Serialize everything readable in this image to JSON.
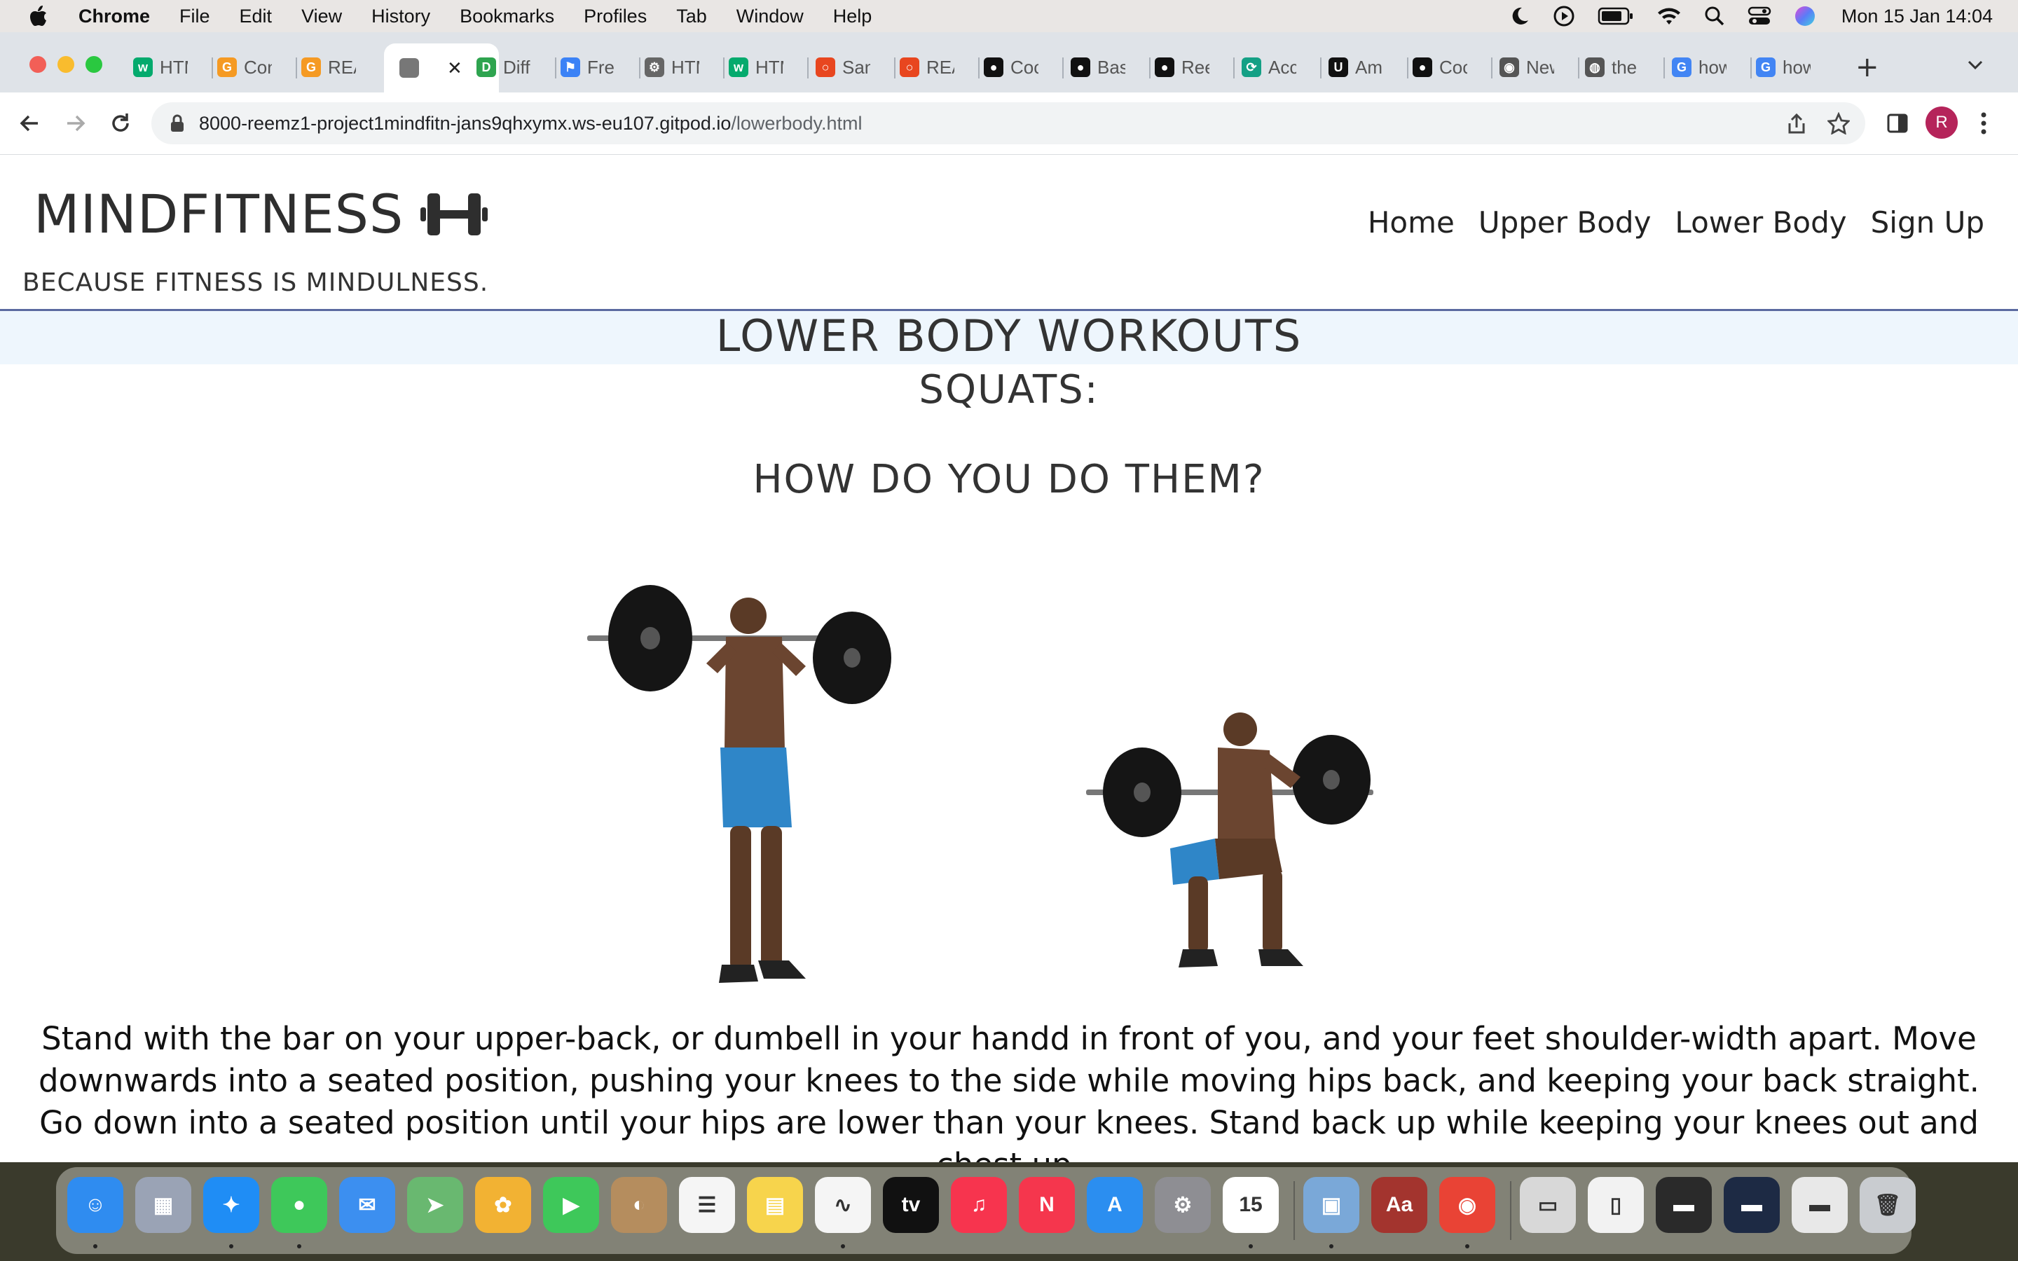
{
  "menubar": {
    "app_name": "Chrome",
    "items": [
      "File",
      "Edit",
      "View",
      "History",
      "Bookmarks",
      "Profiles",
      "Tab",
      "Window",
      "Help"
    ],
    "clock": "Mon 15 Jan  14:04"
  },
  "tabs": [
    {
      "title": "HTML",
      "favicon": "w3schools-icon",
      "color": "#04aa6d",
      "glyph": "w"
    },
    {
      "title": "Con",
      "favicon": "g-orange-icon",
      "color": "#f59a23",
      "glyph": "G"
    },
    {
      "title": "REA",
      "favicon": "g-orange-icon",
      "color": "#f59a23",
      "glyph": "G"
    },
    {
      "title": "",
      "favicon": "page-icon",
      "color": "#777777",
      "glyph": "",
      "active": true
    },
    {
      "title": "Diff",
      "favicon": "diffchecker-icon",
      "color": "#2ea44f",
      "glyph": "D"
    },
    {
      "title": "Free",
      "favicon": "flag-icon",
      "color": "#3b82f6",
      "glyph": "⚑"
    },
    {
      "title": "HTM",
      "favicon": "gear-icon",
      "color": "#666666",
      "glyph": "⚙"
    },
    {
      "title": "HTM",
      "favicon": "w3schools-icon",
      "color": "#04aa6d",
      "glyph": "w"
    },
    {
      "title": "San",
      "favicon": "circle-red-icon",
      "color": "#e8461f",
      "glyph": "○"
    },
    {
      "title": "REA",
      "favicon": "circle-red-icon",
      "color": "#e8461f",
      "glyph": "○"
    },
    {
      "title": "Coc",
      "favicon": "github-icon",
      "color": "#111111",
      "glyph": "●"
    },
    {
      "title": "Bas",
      "favicon": "github-icon",
      "color": "#111111",
      "glyph": "●"
    },
    {
      "title": "Ree",
      "favicon": "github-icon",
      "color": "#111111",
      "glyph": "●"
    },
    {
      "title": "Acc",
      "favicon": "app-icon",
      "color": "#14a085",
      "glyph": "⟳"
    },
    {
      "title": "Am",
      "favicon": "udemy-icon",
      "color": "#111111",
      "glyph": "U"
    },
    {
      "title": "Coc",
      "favicon": "github-icon",
      "color": "#111111",
      "glyph": "●"
    },
    {
      "title": "New",
      "favicon": "chrome-icon",
      "color": "#555555",
      "glyph": "◉"
    },
    {
      "title": "the",
      "favicon": "globe-icon",
      "color": "#555555",
      "glyph": "◍"
    },
    {
      "title": "how",
      "favicon": "google-icon",
      "color": "#4285f4",
      "glyph": "G"
    },
    {
      "title": "how",
      "favicon": "google-icon",
      "color": "#4285f4",
      "glyph": "G"
    }
  ],
  "toolbar": {
    "url_host": "8000-reemz1-project1mindfitn-jans9qhxymx.ws-eu107.gitpod.io",
    "url_path": "/lowerbody.html",
    "avatar_letter": "R"
  },
  "page": {
    "logo_text": "MINDFITNESS",
    "tagline": "BECAUSE FITNESS IS MINDULNESS.",
    "nav": [
      "Home",
      "Upper Body",
      "Lower Body",
      "Sign Up"
    ],
    "heading": "LOWER BODY WORKOUTS",
    "subheading": "SQUATS:",
    "question": "HOW DO YOU DO THEM?",
    "images": [
      "squat-standing-image",
      "squat-bottom-image"
    ],
    "paragraph": "Stand with the bar on your upper-back, or dumbell in your handd in front of you, and your feet shoulder-width apart. Move downwards into a seated position, pushing your knees to the side while moving hips back, and keeping your back straight. Go down into a seated position until your hips are lower than your knees. Stand back up while keeping your knees out and chest up."
  },
  "dock": {
    "apps": [
      {
        "name": "finder-icon",
        "color": "#2f8cf0",
        "glyph": "☺"
      },
      {
        "name": "launchpad-icon",
        "color": "#9aa3b5",
        "glyph": "▦"
      },
      {
        "name": "safari-icon",
        "color": "#1f8df5",
        "glyph": "✦"
      },
      {
        "name": "messages-icon",
        "color": "#3ec85a",
        "glyph": "●"
      },
      {
        "name": "mail-icon",
        "color": "#3c8ff0",
        "glyph": "✉"
      },
      {
        "name": "maps-icon",
        "color": "#69b870",
        "glyph": "➤"
      },
      {
        "name": "photos-icon",
        "color": "#f2b233",
        "glyph": "✿"
      },
      {
        "name": "facetime-icon",
        "color": "#3ec85a",
        "glyph": "▶"
      },
      {
        "name": "contacts-icon",
        "color": "#b58d5e",
        "glyph": "◐"
      },
      {
        "name": "reminders-icon",
        "color": "#f5f5f5",
        "glyph": "☰"
      },
      {
        "name": "notes-icon",
        "color": "#f7d44c",
        "glyph": "▤"
      },
      {
        "name": "freeform-icon",
        "color": "#f5f5f5",
        "glyph": "∿"
      },
      {
        "name": "tv-icon",
        "color": "#111111",
        "glyph": "tv"
      },
      {
        "name": "music-icon",
        "color": "#f7344e",
        "glyph": "♫"
      },
      {
        "name": "news-icon",
        "color": "#f5364d",
        "glyph": "N"
      },
      {
        "name": "app-store-icon",
        "color": "#2b8ef0",
        "glyph": "A"
      },
      {
        "name": "system-settings-icon",
        "color": "#8e8e93",
        "glyph": "⚙"
      },
      {
        "name": "calendar-icon",
        "color": "#ffffff",
        "glyph": "15"
      },
      {
        "name": "preview-icon",
        "color": "#7aa8d8",
        "glyph": "▣"
      },
      {
        "name": "dictionary-icon",
        "color": "#a3342e",
        "glyph": "Aa"
      },
      {
        "name": "chrome-icon",
        "color": "#e94335",
        "glyph": "◉"
      },
      {
        "name": "document-icon",
        "color": "#d8d8d8",
        "glyph": "▭"
      },
      {
        "name": "file-icon",
        "color": "#f2f2f2",
        "glyph": "▯"
      },
      {
        "name": "screenshot-1-icon",
        "color": "#2a2a2a",
        "glyph": "▬"
      },
      {
        "name": "screenshot-2-icon",
        "color": "#1d2a44",
        "glyph": "▬"
      },
      {
        "name": "screenshot-3-icon",
        "color": "#e8e8e8",
        "glyph": "▬"
      },
      {
        "name": "trash-icon",
        "color": "#c9ccd0",
        "glyph": "🗑"
      }
    ]
  }
}
